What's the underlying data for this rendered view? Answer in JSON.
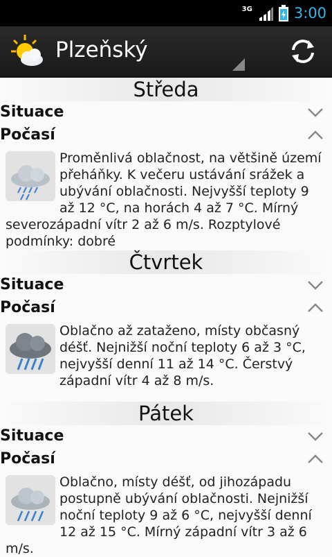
{
  "status": {
    "network": "3G",
    "time": "3:00"
  },
  "app": {
    "title": "Plzeňský"
  },
  "days": [
    {
      "name": "Středa",
      "situation_label": "Situace",
      "weather_label": "Počasí",
      "icon": "showers-icon",
      "text": "Proměnlivá oblačnost, na většině území přeháňky. K večeru ustávání srážek a ubývání oblačnosti. Nejvyšší teploty 9 až 12 °C, na horách 4 až 7 °C. Mírný severozápadní vítr 2 až 6 m/s. Rozptylové podmínky: dobré"
    },
    {
      "name": "Čtvrtek",
      "situation_label": "Situace",
      "weather_label": "Počasí",
      "icon": "heavy-rain-icon",
      "text": "Oblačno až zataženo, místy občasný déšť. Nejnižší noční teploty 6 až 3 °C, nejvyšší denní 11 až 14 °C. Čerstvý západní vítr 4 až 8 m/s."
    },
    {
      "name": "Pátek",
      "situation_label": "Situace",
      "weather_label": "Počasí",
      "icon": "rain-icon",
      "text": "Oblačno, místy déšť, od jihozápadu postupně ubývání oblačnosti. Nejnižší noční teploty 9 až 6 °C, nejvyšší denní 12 až 15 °C. Mírný západní vítr 3 až 6 m/s."
    }
  ]
}
